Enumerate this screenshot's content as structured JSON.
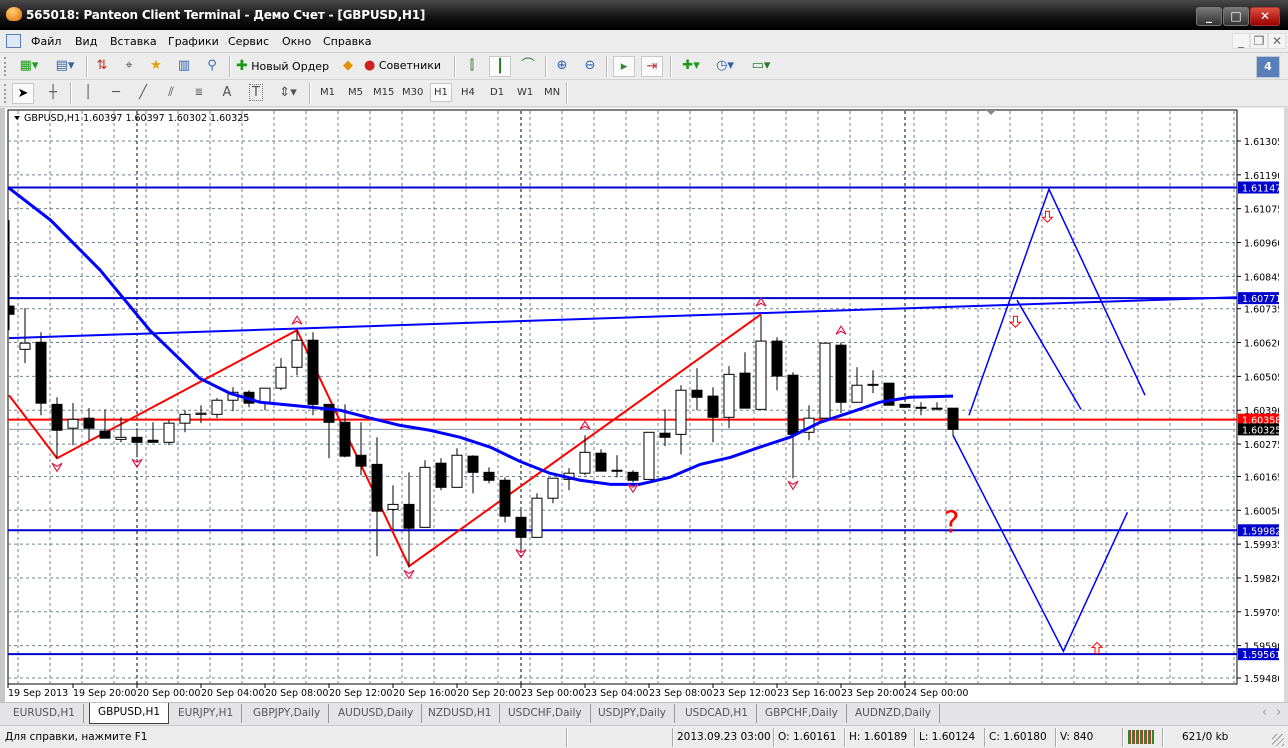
{
  "window": {
    "title": "565018: Panteon Client Terminal - Демо Счет - [GBPUSD,H1]",
    "minimize": "_",
    "maximize": "□",
    "close": "✕"
  },
  "menu": [
    "Файл",
    "Вид",
    "Вставка",
    "Графики",
    "Сервис",
    "Окно",
    "Справка"
  ],
  "toolbar": {
    "new_order": "Новый Ордер",
    "experts": "Советники",
    "notifications_count": "4",
    "timeframes": [
      "M1",
      "M5",
      "M15",
      "M30",
      "H1",
      "H4",
      "D1",
      "W1",
      "MN"
    ],
    "active_timeframe": "H1",
    "text_tool": "A",
    "label_tool": "T"
  },
  "chart_data": {
    "type": "candlestick",
    "symbol_header": "GBPUSD,H1  1.60397 1.60397 1.60302 1.60325",
    "ylim": [
      1.5948,
      1.6136
    ],
    "y_ticks": [
      "1.61305",
      "1.61190",
      "1.61075",
      "1.60960",
      "1.60845",
      "1.60735",
      "1.60620",
      "1.60505",
      "1.60390",
      "1.60275",
      "1.60165",
      "1.60050",
      "1.59935",
      "1.59820",
      "1.59705",
      "1.59590",
      "1.59480"
    ],
    "x_ticks": [
      {
        "bar": 0,
        "label": "19 Sep 2013"
      },
      {
        "bar": 4,
        "label": "19 Sep 20:00"
      },
      {
        "bar": 8,
        "label": "20 Sep 00:00"
      },
      {
        "bar": 12,
        "label": "20 Sep 04:00"
      },
      {
        "bar": 16,
        "label": "20 Sep 08:00"
      },
      {
        "bar": 20,
        "label": "20 Sep 12:00"
      },
      {
        "bar": 24,
        "label": "20 Sep 16:00"
      },
      {
        "bar": 28,
        "label": "20 Sep 20:00"
      },
      {
        "bar": 32,
        "label": "23 Sep 00:00"
      },
      {
        "bar": 36,
        "label": "23 Sep 04:00"
      },
      {
        "bar": 40,
        "label": "23 Sep 08:00"
      },
      {
        "bar": 44,
        "label": "23 Sep 12:00"
      },
      {
        "bar": 48,
        "label": "23 Sep 16:00"
      },
      {
        "bar": 52,
        "label": "23 Sep 20:00"
      },
      {
        "bar": 56,
        "label": "24 Sep 00:00"
      }
    ],
    "day_separators": [
      8,
      32,
      56
    ],
    "candles": [
      [
        1.60744,
        1.61036,
        1.60662,
        1.60716
      ],
      [
        1.60597,
        1.60737,
        1.6055,
        1.60618
      ],
      [
        1.60621,
        1.60655,
        1.60373,
        1.60414
      ],
      [
        1.6041,
        1.60434,
        1.60227,
        1.60322
      ],
      [
        1.60329,
        1.60414,
        1.60271,
        1.60359
      ],
      [
        1.60363,
        1.60397,
        1.60288,
        1.60329
      ],
      [
        1.60319,
        1.60393,
        1.60295,
        1.60295
      ],
      [
        1.60291,
        1.60366,
        1.60281,
        1.60298
      ],
      [
        1.60298,
        1.60329,
        1.6023,
        1.60281
      ],
      [
        1.60288,
        1.60349,
        1.60281,
        1.60281
      ],
      [
        1.60281,
        1.60356,
        1.60271,
        1.60346
      ],
      [
        1.60346,
        1.6039,
        1.60315,
        1.60376
      ],
      [
        1.60376,
        1.60407,
        1.60346,
        1.6038
      ],
      [
        1.60376,
        1.60431,
        1.60363,
        1.60424
      ],
      [
        1.60424,
        1.60468,
        1.60387,
        1.60451
      ],
      [
        1.60451,
        1.60458,
        1.604,
        1.60414
      ],
      [
        1.60417,
        1.60465,
        1.6039,
        1.60465
      ],
      [
        1.60465,
        1.60567,
        1.60458,
        1.60536
      ],
      [
        1.60536,
        1.60662,
        1.60509,
        1.60628
      ],
      [
        1.60628,
        1.60655,
        1.60373,
        1.6041
      ],
      [
        1.6041,
        1.6041,
        1.60227,
        1.60349
      ],
      [
        1.60349,
        1.6041,
        1.6023,
        1.60234
      ],
      [
        1.60237,
        1.60349,
        1.60169,
        1.602
      ],
      [
        1.60206,
        1.60298,
        1.59894,
        1.60047
      ],
      [
        1.60053,
        1.60135,
        1.59982,
        1.6007
      ],
      [
        1.6007,
        1.60179,
        1.59856,
        1.59989
      ],
      [
        1.59992,
        1.6022,
        1.59992,
        1.60196
      ],
      [
        1.6021,
        1.60227,
        1.60118,
        1.60128
      ],
      [
        1.60128,
        1.60261,
        1.60128,
        1.60237
      ],
      [
        1.60234,
        1.60237,
        1.60108,
        1.60179
      ],
      [
        1.60179,
        1.60196,
        1.60142,
        1.60152
      ],
      [
        1.60152,
        1.60162,
        1.60009,
        1.6003
      ],
      [
        1.60026,
        1.6005,
        1.59914,
        1.59958
      ],
      [
        1.59958,
        1.60108,
        1.59958,
        1.60091
      ],
      [
        1.60091,
        1.60159,
        1.60074,
        1.60159
      ],
      [
        1.60155,
        1.60193,
        1.60118,
        1.60176
      ],
      [
        1.60176,
        1.60305,
        1.60169,
        1.60247
      ],
      [
        1.60244,
        1.60257,
        1.60183,
        1.60183
      ],
      [
        1.60183,
        1.60237,
        1.60162,
        1.60186
      ],
      [
        1.60179,
        1.60186,
        1.60145,
        1.60152
      ],
      [
        1.60155,
        1.60315,
        1.60155,
        1.60315
      ],
      [
        1.60312,
        1.60393,
        1.60268,
        1.60298
      ],
      [
        1.60308,
        1.60475,
        1.6024,
        1.60458
      ],
      [
        1.60458,
        1.60533,
        1.6039,
        1.60434
      ],
      [
        1.60438,
        1.60468,
        1.60281,
        1.60366
      ],
      [
        1.60366,
        1.6054,
        1.60329,
        1.60512
      ],
      [
        1.60516,
        1.60587,
        1.60397,
        1.60397
      ],
      [
        1.60393,
        1.60713,
        1.60393,
        1.60625
      ],
      [
        1.60625,
        1.60638,
        1.60458,
        1.60506
      ],
      [
        1.60509,
        1.60519,
        1.60159,
        1.60308
      ],
      [
        1.60315,
        1.60407,
        1.60288,
        1.60363
      ],
      [
        1.60363,
        1.60618,
        1.60363,
        1.60618
      ],
      [
        1.60611,
        1.60621,
        1.6038,
        1.60417
      ],
      [
        1.60417,
        1.60536,
        1.60417,
        1.60475
      ],
      [
        1.60478,
        1.60526,
        1.60448,
        1.60478
      ],
      [
        1.60482,
        1.60482,
        1.60407,
        1.60407
      ],
      [
        1.6041,
        1.6041,
        1.604,
        1.604
      ],
      [
        1.604,
        1.60417,
        1.60373,
        1.604
      ],
      [
        1.60397,
        1.60417,
        1.6039,
        1.60397
      ],
      [
        1.60397,
        1.60397,
        1.60302,
        1.60325
      ]
    ],
    "horizontal_lines": [
      {
        "price": 1.61147,
        "label": "1.61147",
        "color": "#0000cc"
      },
      {
        "price": 1.60771,
        "label": "1.60771",
        "color": "#0000cc"
      },
      {
        "price": 1.60358,
        "label": "1.60358",
        "color": "#ff0000"
      },
      {
        "price": 1.59982,
        "label": "1.59982",
        "color": "#0000cc"
      },
      {
        "price": 1.59561,
        "label": "1.59561",
        "color": "#0000cc"
      }
    ],
    "bid_line": {
      "price": 1.60325,
      "label": "1.60325"
    },
    "trendline": [
      [
        0,
        1.60635
      ],
      [
        76.75,
        1.60774
      ]
    ],
    "moving_average": [
      [
        0,
        1.61145
      ],
      [
        2.6,
        1.61036
      ],
      [
        5.7,
        1.60866
      ],
      [
        8.8,
        1.60662
      ],
      [
        11.9,
        1.60499
      ],
      [
        13.8,
        1.60448
      ],
      [
        15.7,
        1.60417
      ],
      [
        18.2,
        1.60404
      ],
      [
        20.7,
        1.6039
      ],
      [
        22.6,
        1.60363
      ],
      [
        24.4,
        1.60339
      ],
      [
        26.3,
        1.60322
      ],
      [
        28.2,
        1.60298
      ],
      [
        30.1,
        1.60264
      ],
      [
        31.9,
        1.60217
      ],
      [
        33.8,
        1.60176
      ],
      [
        35.7,
        1.60152
      ],
      [
        37.6,
        1.60138
      ],
      [
        39.4,
        1.60138
      ],
      [
        41.3,
        1.60162
      ],
      [
        43.2,
        1.60206
      ],
      [
        45.1,
        1.6023
      ],
      [
        46.9,
        1.60264
      ],
      [
        48.8,
        1.60298
      ],
      [
        50.7,
        1.60349
      ],
      [
        52.6,
        1.60383
      ],
      [
        54.4,
        1.60417
      ],
      [
        56.3,
        1.60434
      ],
      [
        59,
        1.60438
      ]
    ],
    "zigzag": [
      [
        0,
        1.60441
      ],
      [
        3,
        1.60227
      ],
      [
        18,
        1.60662
      ],
      [
        25,
        1.5986
      ],
      [
        47,
        1.60716
      ]
    ],
    "fractals_up": [
      [
        18,
        1.60696
      ],
      [
        36,
        1.60339
      ],
      [
        47,
        1.60757
      ],
      [
        52,
        1.60662
      ]
    ],
    "fractals_down": [
      [
        3,
        1.60196
      ],
      [
        8,
        1.6021
      ],
      [
        25,
        1.59832
      ],
      [
        32,
        1.59903
      ],
      [
        39,
        1.60125
      ],
      [
        49,
        1.60135
      ]
    ],
    "forecast_paths": [
      [
        [
          59,
          1.60305
        ],
        [
          65.9,
          1.59571
        ],
        [
          69.9,
          1.60043
        ]
      ],
      [
        [
          60,
          1.60373
        ],
        [
          65,
          1.61141
        ],
        [
          71,
          1.60441
        ]
      ],
      [
        [
          63,
          1.60764
        ],
        [
          67,
          1.60393
        ]
      ]
    ],
    "arrows_down": [
      [
        64.9,
        1.61046
      ],
      [
        62.9,
        1.60689
      ]
    ],
    "arrows_up": [
      [
        68,
        1.59584
      ]
    ],
    "annotation": {
      "text": "?",
      "bar": 59.1,
      "price": 1.60022,
      "color": "#ff0000"
    },
    "colors": {
      "ma": "#0000ff",
      "zigzag": "#ff0000",
      "fractal": "#e0204a",
      "grid": "#708090"
    }
  },
  "tabs": [
    {
      "label": "EURUSD,H1"
    },
    {
      "label": "GBPUSD,H1",
      "active": true
    },
    {
      "label": "EURJPY,H1"
    },
    {
      "label": "GBPJPY,Daily"
    },
    {
      "label": "AUDUSD,Daily"
    },
    {
      "label": "NZDUSD,H1"
    },
    {
      "label": "USDCHF,Daily"
    },
    {
      "label": "USDJPY,Daily"
    },
    {
      "label": "USDCAD,H1"
    },
    {
      "label": "GBPCHF,Daily"
    },
    {
      "label": "AUDNZD,Daily"
    }
  ],
  "status": {
    "help": "Для справки, нажмите F1",
    "datetime": "2013.09.23 03:00",
    "open": "O: 1.60161",
    "high": "H: 1.60189",
    "low": "L: 1.60124",
    "close": "C: 1.60180",
    "volume": "V: 840",
    "traffic": "621/0 kb"
  }
}
